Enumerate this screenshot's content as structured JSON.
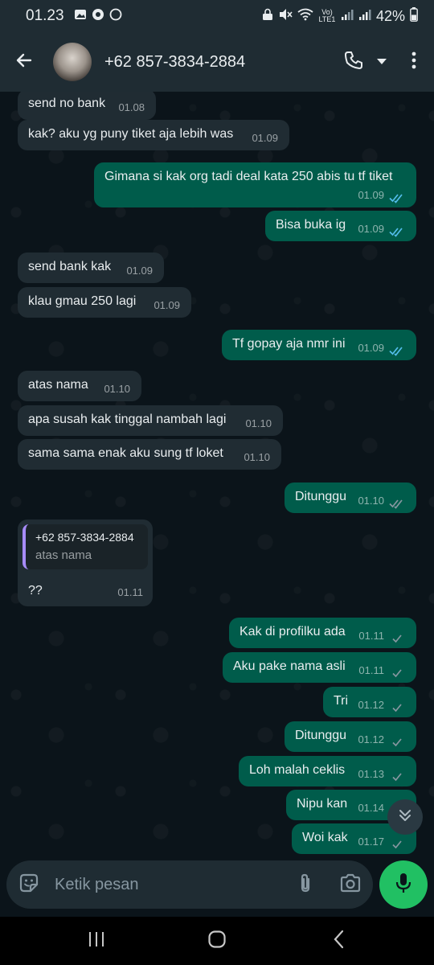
{
  "status_bar": {
    "time": "01.23",
    "network_label": "Vo) LTE1",
    "battery": "42%"
  },
  "header": {
    "contact_name": "+62 857-3834-2884"
  },
  "messages": [
    {
      "dir": "in",
      "text": "send no bank",
      "time": "01.08"
    },
    {
      "dir": "in",
      "text": "kak? aku yg puny tiket aja lebih was",
      "time": "01.09"
    },
    {
      "dir": "out",
      "text": "Gimana si kak org tadi deal kata 250 abis tu tf tiket",
      "time": "01.09",
      "status": "read"
    },
    {
      "dir": "out",
      "text": "Bisa buka ig",
      "time": "01.09",
      "status": "read"
    },
    {
      "dir": "in",
      "text": "send bank kak",
      "time": "01.09"
    },
    {
      "dir": "in",
      "text": "klau gmau 250 lagi",
      "time": "01.09"
    },
    {
      "dir": "out",
      "text": "Tf gopay aja nmr ini",
      "time": "01.09",
      "status": "read"
    },
    {
      "dir": "in",
      "text": "atas nama",
      "time": "01.10"
    },
    {
      "dir": "in",
      "text": "apa susah kak tinggal nambah lagi",
      "time": "01.10"
    },
    {
      "dir": "in",
      "text": "sama sama enak aku sung tf loket",
      "time": "01.10"
    },
    {
      "dir": "out",
      "text": "Ditunggu",
      "time": "01.10",
      "status": "read"
    },
    {
      "dir": "in",
      "text": "??",
      "time": "01.11",
      "quote": {
        "author": "+62 857-3834-2884",
        "text": "atas nama"
      }
    },
    {
      "dir": "out",
      "text": "Kak di profilku ada",
      "time": "01.11",
      "status": "sent"
    },
    {
      "dir": "out",
      "text": "Aku pake nama asli",
      "time": "01.11",
      "status": "sent"
    },
    {
      "dir": "out",
      "text": "Tri",
      "time": "01.12",
      "status": "sent"
    },
    {
      "dir": "out",
      "text": "Ditunggu",
      "time": "01.12",
      "status": "sent"
    },
    {
      "dir": "out",
      "text": "Loh malah ceklis",
      "time": "01.13",
      "status": "sent"
    },
    {
      "dir": "out",
      "text": "Nipu kan",
      "time": "01.14",
      "status": "sent"
    },
    {
      "dir": "out",
      "text": "Woi kak",
      "time": "01.17",
      "status": "sent"
    }
  ],
  "composer": {
    "placeholder": "Ketik pesan"
  },
  "colors": {
    "incoming_bubble": "#202c33",
    "outgoing_bubble": "#005c4b",
    "read_tick": "#53bdeb",
    "mic_button": "#21c063",
    "quote_bar": "#a78bfa"
  },
  "icons": {
    "back": "arrow-left-icon",
    "call": "phone-icon",
    "menu": "more-vertical-icon",
    "attach": "paperclip-icon",
    "camera": "camera-icon",
    "sticker": "sticker-icon",
    "mic": "microphone-icon",
    "scroll": "double-chevron-down-icon"
  }
}
